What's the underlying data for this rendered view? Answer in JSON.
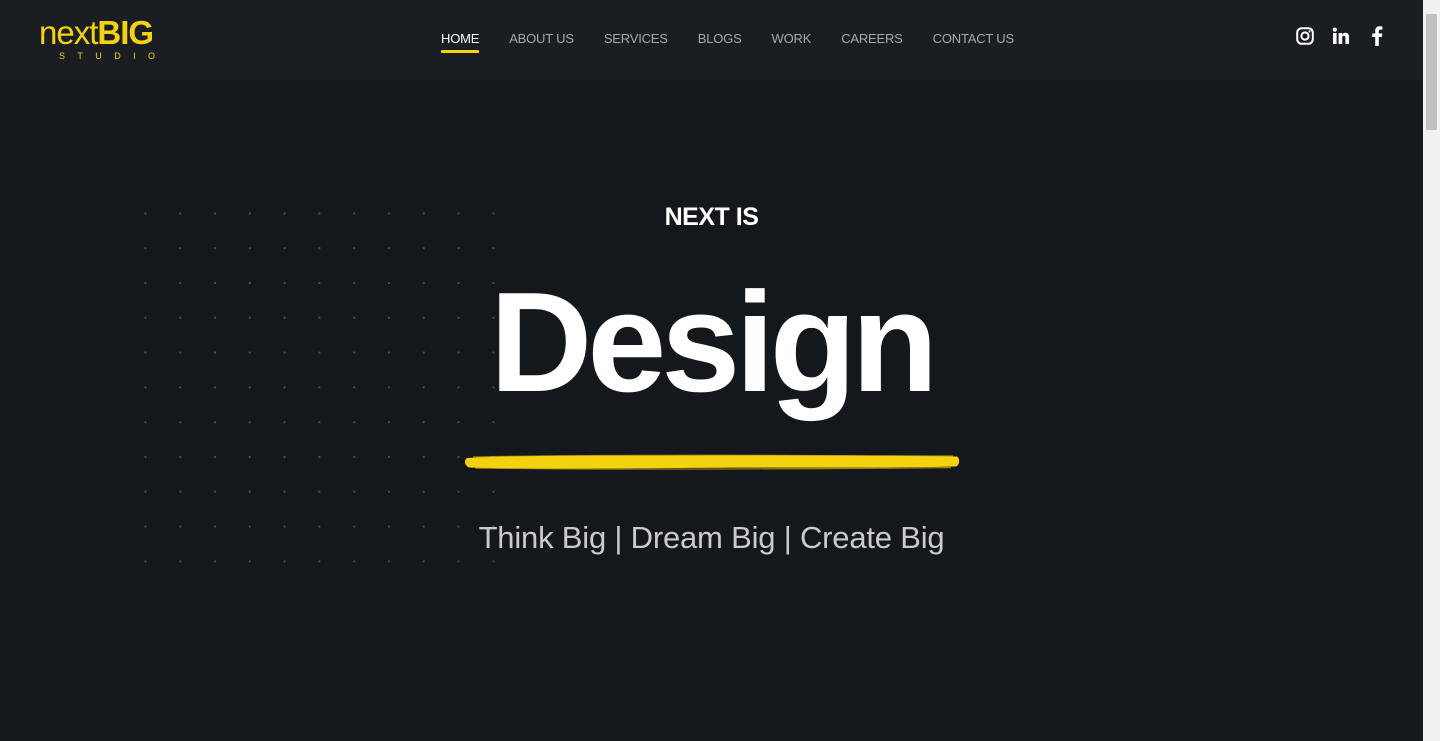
{
  "logo": {
    "word_light": "next",
    "word_bold": "BIG",
    "sub": "STUDIO"
  },
  "nav": {
    "items": [
      {
        "label": "HOME",
        "active": true
      },
      {
        "label": "ABOUT US",
        "active": false
      },
      {
        "label": "SERVICES",
        "active": false
      },
      {
        "label": "BLOGS",
        "active": false
      },
      {
        "label": "WORK",
        "active": false
      },
      {
        "label": "CAREERS",
        "active": false
      },
      {
        "label": "CONTACT US",
        "active": false
      }
    ]
  },
  "social": {
    "icons": [
      "instagram-icon",
      "linkedin-icon",
      "facebook-icon"
    ]
  },
  "hero": {
    "eyebrow": "NEXT IS",
    "headline": "Design",
    "tagline": "Think Big | Dream Big | Create Big"
  },
  "colors": {
    "accent": "#f5d20f",
    "background": "#14171c",
    "header": "#1a1d22"
  }
}
